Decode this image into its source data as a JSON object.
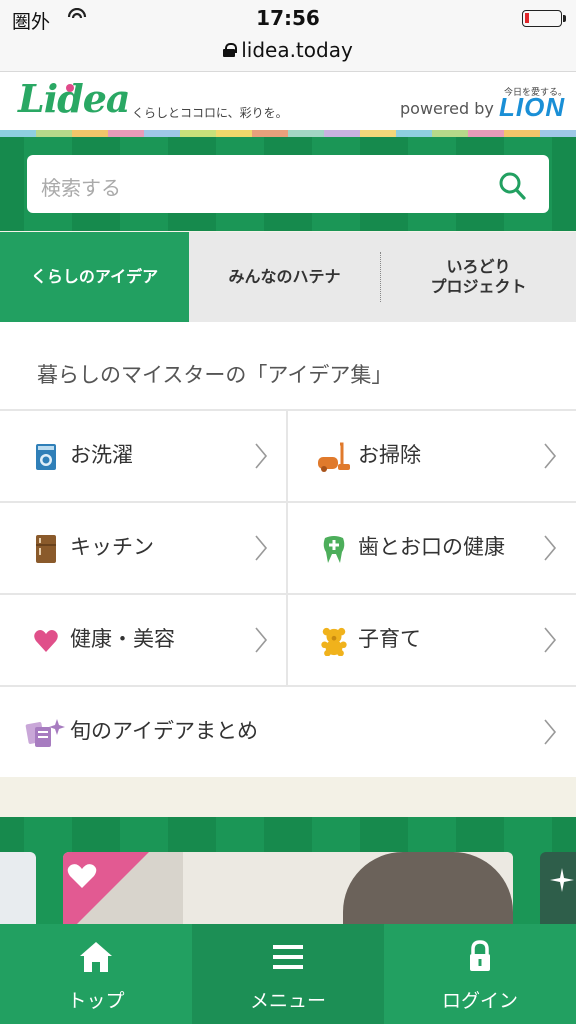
{
  "status_bar": {
    "carrier": "圏外",
    "time": "17:56"
  },
  "browser": {
    "url": "lidea.today"
  },
  "header": {
    "logo": "Lidea",
    "tagline": "くらしとココロに、彩りを。",
    "powered_by": "powered by",
    "brand_small": "今日を愛する。",
    "brand": "LION"
  },
  "search": {
    "placeholder": "検索する"
  },
  "tabs": [
    {
      "label": "くらしのアイデア",
      "active": true
    },
    {
      "label": "みんなのハテナ",
      "active": false
    },
    {
      "label_line1": "いろどり",
      "label_line2": "プロジェクト",
      "active": false
    }
  ],
  "main": {
    "heading": "暮らしのマイスターの「アイデア集」",
    "categories": [
      {
        "label": "お洗濯",
        "icon": "washing-machine-icon"
      },
      {
        "label": "お掃除",
        "icon": "vacuum-cleaner-icon"
      },
      {
        "label": "キッチン",
        "icon": "refrigerator-icon"
      },
      {
        "label": "歯とお口の健康",
        "icon": "tooth-icon"
      },
      {
        "label": "健康・美容",
        "icon": "heart-icon"
      },
      {
        "label": "子育て",
        "icon": "teddy-bear-icon"
      }
    ],
    "summary": {
      "label": "旬のアイデアまとめ",
      "icon": "sparkle-cards-icon"
    }
  },
  "bottom_nav": [
    {
      "label": "トップ",
      "icon": "home-icon"
    },
    {
      "label": "メニュー",
      "icon": "menu-icon"
    },
    {
      "label": "ログイン",
      "icon": "lock-icon"
    }
  ],
  "colors": {
    "brand_green": "#22a061",
    "dark_green": "#168a4d",
    "lion_blue": "#1a8fd6"
  }
}
